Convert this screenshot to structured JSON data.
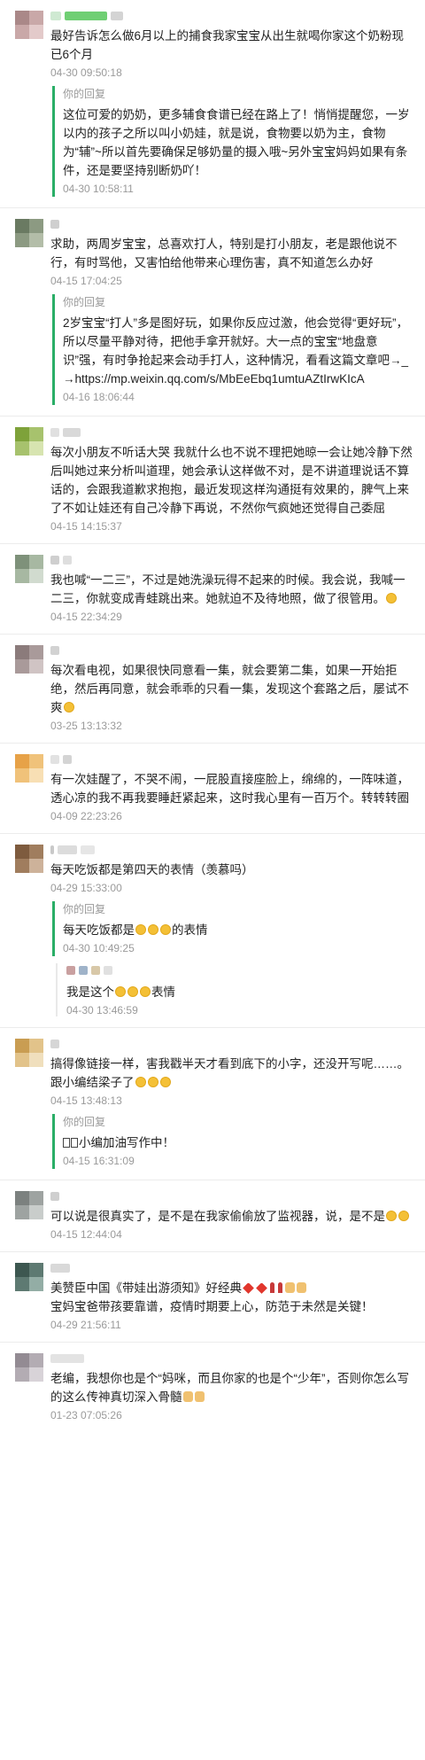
{
  "reply_label": "你的回复",
  "comments": [
    {
      "text": "最好告诉怎么做6月以上的捕食我家宝宝从出生就喝你家这个奶粉现已6个月",
      "time": "04-30 09:50:18",
      "reply": {
        "text": "这位可爱的奶奶，更多辅食食谱已经在路上了！悄悄提醒您，一岁以内的孩子之所以叫小奶娃，就是说，食物要以奶为主，食物为“辅”~所以首先要确保足够奶量的摄入哦~另外宝宝妈妈如果有条件，还是要坚持别断奶吖！",
        "time": "04-30 10:58:11"
      }
    },
    {
      "text": "求助，两周岁宝宝，总喜欢打人，特别是打小朋友，老是跟他说不行，有时骂他，又害怕给他带来心理伤害，真不知道怎么办好",
      "time": "04-15 17:04:25",
      "reply": {
        "text": "2岁宝宝“打人”多是图好玩，如果你反应过激，他会觉得“更好玩”，所以尽量平静对待，把他手拿开就好。大一点的宝宝“地盘意识”强，有时争抢起来会动手打人，这种情况，看看这篇文章吧→_→https://mp.weixin.qq.com/s/MbEeEbq1umtuAZtIrwKIcA",
        "time": "04-16 18:06:44"
      }
    },
    {
      "text": "每次小朋友不听话大哭 我就什么也不说不理把她晾一会让她冷静下然后叫她过来分析叫道理，她会承认这样做不对，是不讲道理说话不算话的，会跟我道歉求抱抱，最近发现这样沟通挺有效果的，脾气上来了不如让娃还有自己冷静下再说，不然你气疯她还觉得自己委屈",
      "time": "04-15 14:15:37"
    },
    {
      "text": "我也喊“一二三”，不过是她洗澡玩得不起来的时候。我会说，我喊一二三，你就变成青蛙跳出来。她就迫不及待地照，做了很管用。",
      "time": "04-15 22:34:29"
    },
    {
      "text": "每次看电视，如果很快同意看一集，就会要第二集，如果一开始拒绝，然后再同意，就会乖乖的只看一集，发现这个套路之后，屡试不爽",
      "time": "03-25 13:13:32"
    },
    {
      "text": "有一次娃醒了，不哭不闹，一屁股直接座脸上，绵绵的，一阵味道，透心凉的我不再我要睡赶紧起来，这时我心里有一百万个。转转转圈",
      "time": "04-09 22:23:26"
    },
    {
      "text": "每天吃饭都是第四天的表情（羡慕吗）",
      "time": "04-29 15:33:00",
      "reply": {
        "text": "每天吃饭都是",
        "text_after": "的表情",
        "time": "04-30 10:49:25"
      },
      "sub": {
        "text": "我是这个",
        "text_after": "表情",
        "time": "04-30 13:46:59"
      }
    },
    {
      "text": "搞得像链接一样，害我戳半天才看到底下的小字，还没开写呢……。跟小编结梁子了",
      "time": "04-15 13:48:13",
      "reply": {
        "text": "小编加油写作中！",
        "time": "04-15 16:31:09"
      }
    },
    {
      "text": "可以说是很真实了，是不是在我家偷偷放了监视器，说，是不是",
      "time": "04-15 12:44:04"
    },
    {
      "text": "美赞臣中国《带娃出游须知》好经典",
      "text2": "宝妈宝爸带孩要靠谱，疫情时期要上心，防范于未然是关键！",
      "time": "04-29 21:56:11"
    },
    {
      "text": "老编，我想你也是个“妈咪，而且你家的也是个“少年”，否则你怎么写的这么传神真切深入骨髓",
      "time": "01-23 07:05:26"
    }
  ]
}
